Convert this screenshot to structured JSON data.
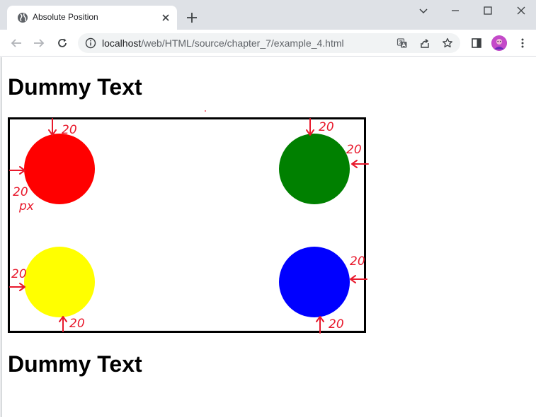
{
  "browser": {
    "tab": {
      "title": "Absolute Position",
      "favicon": "globe-icon"
    },
    "address_bar": {
      "host": "localhost",
      "path": "/web/HTML/source/chapter_7/example_4.html"
    }
  },
  "page": {
    "heading_top": "Dummy Text",
    "heading_bottom": "Dummy Text",
    "circles": [
      {
        "name": "top-left",
        "color": "#ff0000"
      },
      {
        "name": "top-right",
        "color": "#008000"
      },
      {
        "name": "bottom-left",
        "color": "#ffff00"
      },
      {
        "name": "bottom-right",
        "color": "#0000ff"
      }
    ],
    "annotations": {
      "top_left_top": "20",
      "top_left_left": "20",
      "top_left_unit": "px",
      "top_right_top": "20",
      "top_right_right": "20",
      "bottom_left_left": "20",
      "bottom_left_bottom": "20",
      "bottom_right_right": "20",
      "bottom_right_bottom": "20"
    }
  },
  "colors": {
    "annotation": "#e8192c",
    "box_border": "#000000",
    "chrome": "#dee1e6"
  }
}
